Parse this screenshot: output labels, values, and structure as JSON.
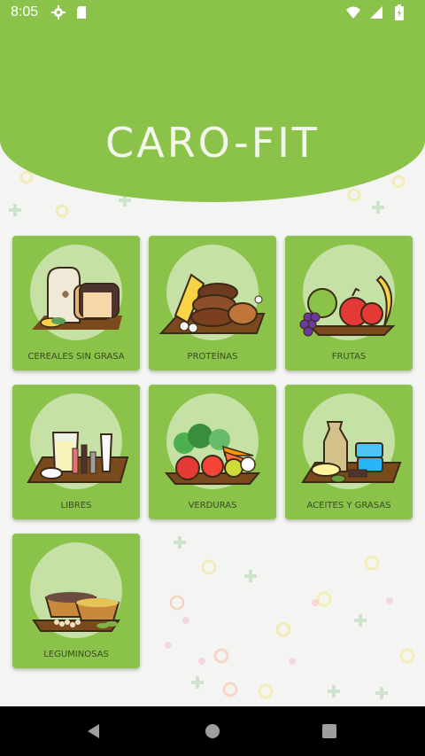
{
  "status_bar": {
    "time": "8:05",
    "left_icons": [
      "settings-icon",
      "sd-card-icon"
    ],
    "right_icons": [
      "wifi-icon",
      "signal-icon",
      "battery-icon"
    ]
  },
  "app": {
    "title": "CARO-FIT",
    "accent_color": "#8bc34a"
  },
  "categories": [
    {
      "label": "CEREALES SIN GRASA",
      "icon": "bread-icon"
    },
    {
      "label": "PROTEÍNAS",
      "icon": "meat-cheese-icon"
    },
    {
      "label": "FRUTAS",
      "icon": "fruit-icon"
    },
    {
      "label": "LIBRES",
      "icon": "drinks-icon"
    },
    {
      "label": "VERDURAS",
      "icon": "vegetables-icon"
    },
    {
      "label": "ACEITES Y GRASAS",
      "icon": "oils-icon"
    },
    {
      "label": "LEGUMINOSAS",
      "icon": "legumes-icon"
    }
  ],
  "nav_bar": {
    "buttons": [
      "back-icon",
      "home-icon",
      "recents-icon"
    ]
  }
}
